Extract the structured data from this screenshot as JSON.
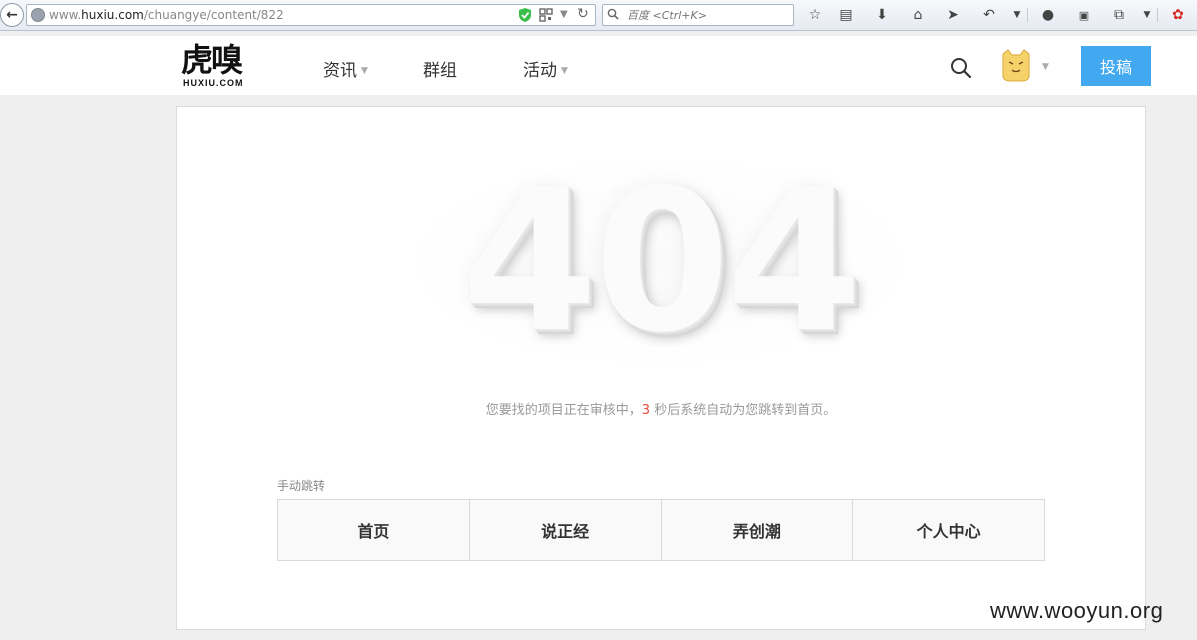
{
  "browser": {
    "url_prefix": "www.",
    "url_domain": "huxiu.com",
    "url_path": "/chuangye/content/822",
    "search_placeholder": "百度 <Ctrl+K>",
    "icons": [
      "back-icon",
      "globe-icon",
      "shield-icon",
      "qr-code-icon",
      "dropdown-icon",
      "reload-icon",
      "search-icon",
      "star-icon",
      "reading-list-icon",
      "download-icon",
      "home-icon",
      "send-icon",
      "undo-icon",
      "menu-dropdown-icon",
      "user-icon",
      "reader-icon",
      "crop-icon",
      "overflow-dropdown-icon",
      "extension-icon"
    ]
  },
  "header": {
    "logo_main": "虎嗅",
    "logo_sub": "HUXIU.COM",
    "nav": [
      {
        "label": "资讯",
        "has_dropdown": true
      },
      {
        "label": "群组",
        "has_dropdown": false
      },
      {
        "label": "活动",
        "has_dropdown": true
      }
    ],
    "submit_label": "投稿",
    "accent_color": "#42a8f0"
  },
  "main": {
    "error_code": "404",
    "message_before": "您要找的项目正在审核中，",
    "countdown": "3",
    "message_after": " 秒后系统自动为您跳转到首页。",
    "manual_label": "手动跳转",
    "links": [
      "首页",
      "说正经",
      "弄创潮",
      "个人中心"
    ]
  },
  "watermark": "www.wooyun.org"
}
